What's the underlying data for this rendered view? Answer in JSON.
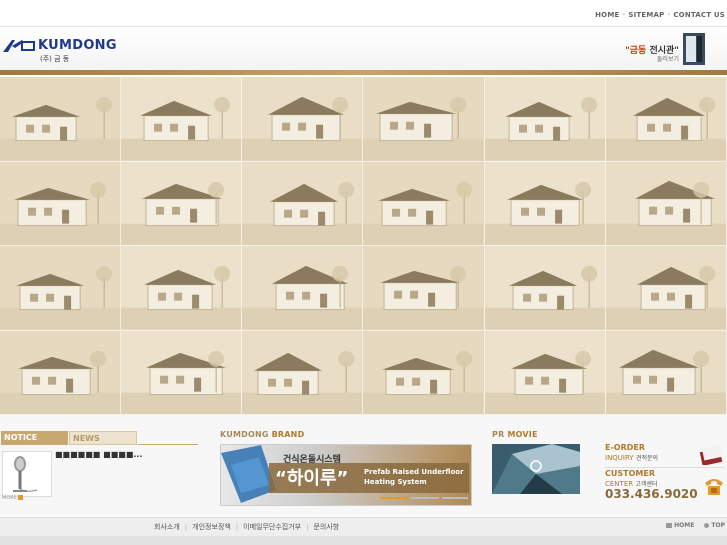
{
  "top_links": [
    "HOME",
    "SITEMAP",
    "CONTACT US"
  ],
  "logo": {
    "name": "KUMDONG",
    "sub": "(주) 금 동"
  },
  "banner": {
    "line1_highlight": "\"금동",
    "line1_rest": " 전시관\"",
    "line2": "둘러보기"
  },
  "notice": {
    "tab_notice": "NOTICE",
    "tab_news": "NEWS",
    "item": "■■■■■■ ■■■■...",
    "more": "MORE"
  },
  "brand": {
    "title_a": "KUMDONG",
    "title_b": "BRAND",
    "korean_top": "건식온돌시스템",
    "korean_main": "“하이루”",
    "english_line1": "Prefab Raised Underfloor",
    "english_line2": "Heating System"
  },
  "movie": {
    "title_a": "PR",
    "title_b": "MOVIE"
  },
  "eorder": {
    "title": "E-ORDER",
    "inquiry_en": "INQUIRY",
    "inquiry_ko": "견적문의",
    "cs_title": "CUSTOMER",
    "cs_center": "CENTER",
    "cs_ko": "고객센터",
    "phone": "033.436.9020"
  },
  "footer": {
    "links": [
      "회사소개",
      "개인정보정책",
      "이메일무단수집거부",
      "문의사항"
    ],
    "home": "HOME",
    "top": "TOP"
  },
  "colors": {
    "gold": "#c9a870",
    "brand_blue": "#1f3a8a",
    "accent_orange": "#e39a2c"
  }
}
